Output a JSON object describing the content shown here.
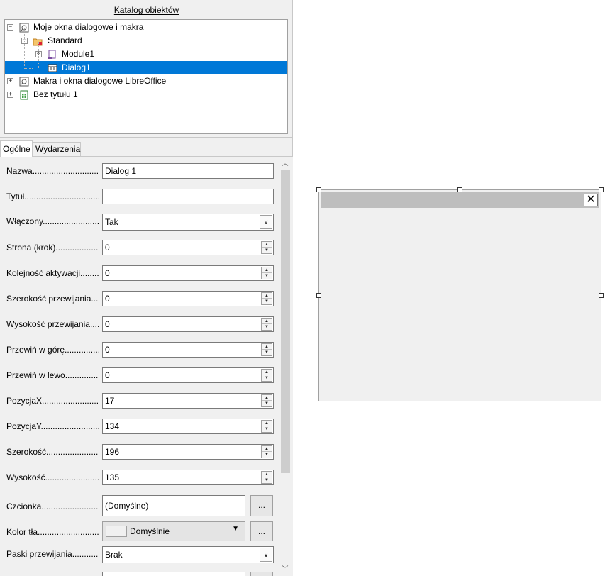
{
  "catalog": {
    "title": "Katalog obiektów",
    "tree": [
      {
        "label": "Moje okna dialogowe i makra",
        "expander": "−",
        "icon": "macro-library-icon"
      },
      {
        "label": "Standard",
        "expander": "−",
        "icon": "folder-library-icon"
      },
      {
        "label": "Module1",
        "expander": "+",
        "icon": "basic-module-icon"
      },
      {
        "label": "Dialog1",
        "expander": "",
        "icon": "dialog-icon",
        "selected": true
      },
      {
        "label": "Makra i okna dialogowe LibreOffice",
        "expander": "+",
        "icon": "macro-library-icon"
      },
      {
        "label": "Bez tytułu 1",
        "expander": "+",
        "icon": "spreadsheet-icon"
      }
    ]
  },
  "tabs": {
    "general": "Ogólne",
    "events": "Wydarzenia"
  },
  "properties": {
    "name": {
      "label": "Nazwa",
      "value": "Dialog 1"
    },
    "title": {
      "label": "Tytuł",
      "value": ""
    },
    "enabled": {
      "label": "Włączony",
      "value": "Tak"
    },
    "page_step": {
      "label": "Strona (krok)",
      "value": "0"
    },
    "tab_order": {
      "label": "Kolejność aktywacji",
      "value": "0"
    },
    "scroll_width": {
      "label": "Szerokość przewijania",
      "value": "0"
    },
    "scroll_height": {
      "label": "Wysokość przewijania",
      "value": "0"
    },
    "scroll_top": {
      "label": "Przewiń w górę",
      "value": "0"
    },
    "scroll_left": {
      "label": "Przewiń w lewo",
      "value": "0"
    },
    "pos_x": {
      "label": "PozycjaX",
      "value": "17"
    },
    "pos_y": {
      "label": "PozycjaY",
      "value": "134"
    },
    "width": {
      "label": "Szerokość",
      "value": "196"
    },
    "height": {
      "label": "Wysokość",
      "value": "135"
    },
    "font": {
      "label": "Czcionka",
      "value": "(Domyślne)",
      "button": "..."
    },
    "background": {
      "label": "Kolor tła",
      "value": "Domyślnie",
      "button": "..."
    },
    "scrollbars": {
      "label": "Paski przewijania",
      "value": "Brak"
    }
  },
  "dialog_preview": {
    "close_glyph": "✕"
  }
}
